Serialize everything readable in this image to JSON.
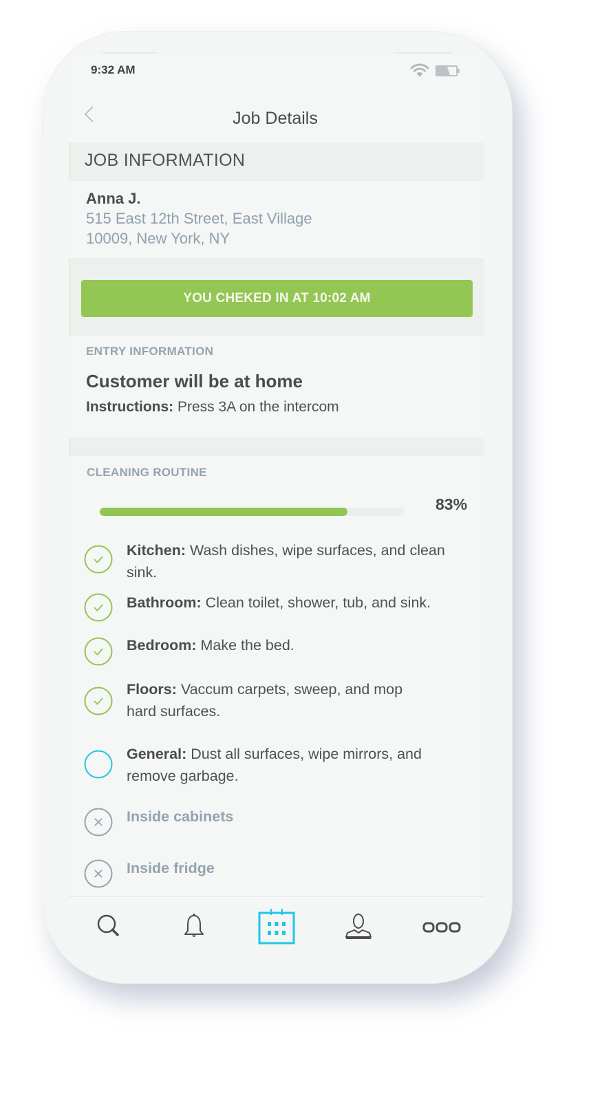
{
  "status_bar": {
    "time": "9:32 AM",
    "icons": [
      "wifi-icon",
      "battery-icon"
    ]
  },
  "header": {
    "back_icon": "chevron-left-icon",
    "title": "Job Details"
  },
  "job_information": {
    "section_title": "JOB INFORMATION",
    "customer_name": "Anna J.",
    "address_line1": "515 East 12th Street, East Village",
    "address_line2": "10009, New York, NY"
  },
  "checkin": {
    "label": "YOU CHEKED IN AT 10:02 AM",
    "color": "#94c653"
  },
  "entry_information": {
    "section_title": "ENTRY INFORMATION",
    "headline": "Customer will be at home",
    "instructions_label": "Instructions:",
    "instructions_text": " Press 3A on the intercom"
  },
  "cleaning_routine": {
    "section_title": "CLEANING ROUTINE",
    "progress_percent": 83,
    "progress_label": "83%",
    "tasks": [
      {
        "status": "done",
        "title": "Kitchen:",
        "description": " Wash dishes, wipe surfaces, and clean sink."
      },
      {
        "status": "done",
        "title": "Bathroom:",
        "description": " Clean toilet, shower, tub, and sink."
      },
      {
        "status": "done",
        "title": "Bedroom:",
        "description": " Make the bed."
      },
      {
        "status": "done",
        "title": "Floors:",
        "description": " Vaccum carpets, sweep, and mop hard surfaces."
      },
      {
        "status": "pending",
        "title": "General:",
        "description": " Dust all surfaces, wipe mirrors, and remove garbage."
      },
      {
        "status": "excluded",
        "title": "Inside cabinets",
        "description": ""
      },
      {
        "status": "excluded",
        "title": "Inside fridge",
        "description": ""
      }
    ]
  },
  "bottom_nav": {
    "items": [
      {
        "name": "search",
        "icon": "search-icon",
        "active": false
      },
      {
        "name": "notifications",
        "icon": "bell-icon",
        "active": false
      },
      {
        "name": "calendar",
        "icon": "calendar-icon",
        "active": true
      },
      {
        "name": "profile",
        "icon": "user-icon",
        "active": false
      },
      {
        "name": "more",
        "icon": "more-icon",
        "active": false
      }
    ]
  },
  "colors": {
    "accent_green": "#92c552",
    "accent_cyan": "#1fc6e6",
    "muted_gray": "#94a3ae",
    "text_dark": "#4a4c4f"
  }
}
